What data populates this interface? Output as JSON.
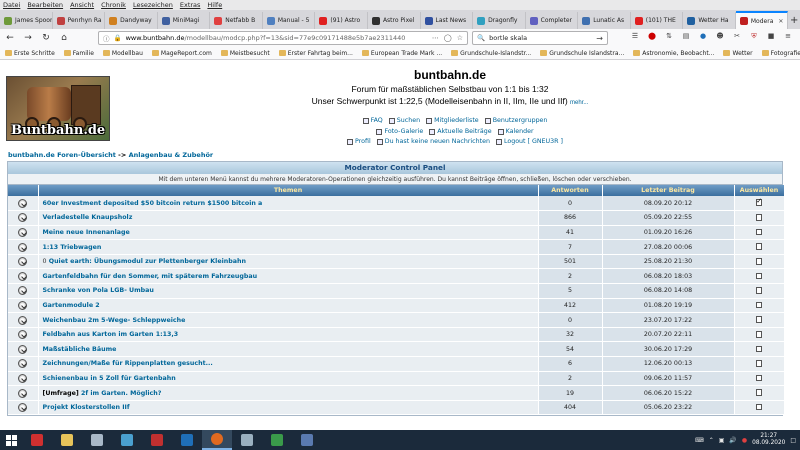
{
  "menubar": [
    "Datei",
    "Bearbeiten",
    "Ansicht",
    "Chronik",
    "Lesezeichen",
    "Extras",
    "Hilfe"
  ],
  "tabs": [
    {
      "label": "James Spooner",
      "color": "#6e9a3a"
    },
    {
      "label": "Penrhyn Ra",
      "color": "#c04040"
    },
    {
      "label": "Dandyway",
      "color": "#d08020"
    },
    {
      "label": "MiniMagi",
      "color": "#4060a0"
    },
    {
      "label": "Netfabb B",
      "color": "#e04040"
    },
    {
      "label": "Manual - 5",
      "color": "#5080c0"
    },
    {
      "label": "(91) Astro",
      "color": "#e02020"
    },
    {
      "label": "Astro Pixel",
      "color": "#303030"
    },
    {
      "label": "Last News",
      "color": "#3050a0"
    },
    {
      "label": "Dragonfly",
      "color": "#30a0c0"
    },
    {
      "label": "Completer",
      "color": "#6060c0"
    },
    {
      "label": "Lunatic As",
      "color": "#4070b0"
    },
    {
      "label": "(101) THE",
      "color": "#e02020"
    },
    {
      "label": "Wetter Ha",
      "color": "#2060a0"
    },
    {
      "label": "Modera",
      "color": "#c02020"
    }
  ],
  "nav": {
    "url_host": "www.buntbahn.de",
    "url_path": "/modellbau/modcp.php?f=13&sid=77e9c09171488e5b7ae2311440",
    "search_value": "bortle skala",
    "zoom_icon": "more-dots-icon"
  },
  "bookmarks": [
    "Erste Schritte",
    "Familie",
    "Modellbau",
    "MageReport.com",
    "Meistbesucht",
    "Erster Fahrtag beim...",
    "European Trade Mark ...",
    "Grundschule-Islandstr...",
    "Grundschule Islandstra...",
    "Astronomie, Beobacht...",
    "Wetter",
    "Fotografie"
  ],
  "header": {
    "logo_text": "Buntbahn.de",
    "title": "buntbahn.de",
    "subtitle": "Forum für maßstäblichen Selbstbau von 1:1 bis 1:32",
    "focus": "Unser Schwerpunkt ist 1:22,5 (Modelleisenbahn in II, IIm, IIe und IIf)",
    "more": "mehr..."
  },
  "navlinks": {
    "faq": "FAQ",
    "search": "Suchen",
    "members": "Mitgliederliste",
    "groups": "Benutzergruppen",
    "gallery": "Foto-Galerie",
    "current": "Aktuelle Beiträge",
    "calendar": "Kalender",
    "profile": "Profil",
    "messages": "Du hast keine neuen Nachrichten",
    "logout": "Logout [ GNEU3R ]"
  },
  "breadcrumb": {
    "home": "buntbahn.de Foren-Übersicht",
    "sep": " -> ",
    "forum": "Anlagenbau & Zubehör"
  },
  "panel": {
    "title": "Moderator Control Panel",
    "info": "Mit dem unteren Menü kannst du mehrere Moderatoren-Operationen gleichzeitig ausführen. Du kannst Beiträge öffnen, schließen, löschen oder verschieben.",
    "col_topics": "Themen",
    "col_replies": "Antworten",
    "col_last": "Letzter Beitrag",
    "col_select": "Auswählen"
  },
  "topics": [
    {
      "title": "60er Investment deposited $50 bitcoin return $1500 bitcoin a",
      "prefix": "",
      "replies": "0",
      "last": "08.09.20 20:12",
      "checked": true
    },
    {
      "title": "Verladestelle Knaupsholz",
      "prefix": "",
      "replies": "866",
      "last": "05.09.20 22:55",
      "checked": false
    },
    {
      "title": "Meine neue Innenanlage",
      "prefix": "",
      "replies": "41",
      "last": "01.09.20 16:26",
      "checked": false
    },
    {
      "title": "1:13 Triebwagen",
      "prefix": "",
      "replies": "7",
      "last": "27.08.20 00:06",
      "checked": false
    },
    {
      "title": "Quiet earth: Übungsmodul zur Plettenberger Kleinbahn",
      "prefix": "0",
      "replies": "501",
      "last": "25.08.20 21:30",
      "checked": false
    },
    {
      "title": "Gartenfeldbahn für den Sommer, mit späterem Fahrzeugbau",
      "prefix": "",
      "replies": "2",
      "last": "06.08.20 18:03",
      "checked": false
    },
    {
      "title": "Schranke von Pola LGB- Umbau",
      "prefix": "",
      "replies": "5",
      "last": "06.08.20 14:08",
      "checked": false
    },
    {
      "title": "Gartenmodule 2",
      "prefix": "",
      "replies": "412",
      "last": "01.08.20 19:19",
      "checked": false
    },
    {
      "title": "Weichenbau 2m 5-Wege- Schleppweiche",
      "prefix": "",
      "replies": "0",
      "last": "23.07.20 17:22",
      "checked": false
    },
    {
      "title": "Feldbahn aus Karton im Garten 1:13,3",
      "prefix": "",
      "replies": "32",
      "last": "20.07.20 22:11",
      "checked": false
    },
    {
      "title": "Maßstäbliche Bäume",
      "prefix": "",
      "replies": "54",
      "last": "30.06.20 17:29",
      "checked": false
    },
    {
      "title": "Zeichnungen/Maße für Rippenplatten gesucht...",
      "prefix": "",
      "replies": "6",
      "last": "12.06.20 00:13",
      "checked": false
    },
    {
      "title": "Schienenbau in 5 Zoll für Gartenbahn",
      "prefix": "",
      "replies": "2",
      "last": "09.06.20 11:57",
      "checked": false
    },
    {
      "title": "2f im Garten. Möglich?",
      "prefix": "[Umfrage]",
      "replies": "19",
      "last": "06.06.20 15:22",
      "checked": false
    },
    {
      "title": "Projekt Klosterstollen IIf",
      "prefix": "",
      "replies": "404",
      "last": "05.06.20 23:22",
      "checked": false
    }
  ],
  "taskbar": {
    "apps": [
      {
        "name": "shield-app",
        "color": "#d03030"
      },
      {
        "name": "explorer",
        "color": "#e6c35a"
      },
      {
        "name": "notes",
        "color": "#a8b8c8"
      },
      {
        "name": "layers",
        "color": "#4aa0d0"
      },
      {
        "name": "spider",
        "color": "#c03030"
      },
      {
        "name": "photoshop",
        "color": "#1f6fb8"
      },
      {
        "name": "firefox",
        "color": "#e06a20"
      },
      {
        "name": "file",
        "color": "#9ab0c0"
      },
      {
        "name": "stacks",
        "color": "#3a9a4a"
      },
      {
        "name": "remote",
        "color": "#5a7ab0"
      }
    ],
    "time": "21:27",
    "date": "08.09.2020"
  }
}
